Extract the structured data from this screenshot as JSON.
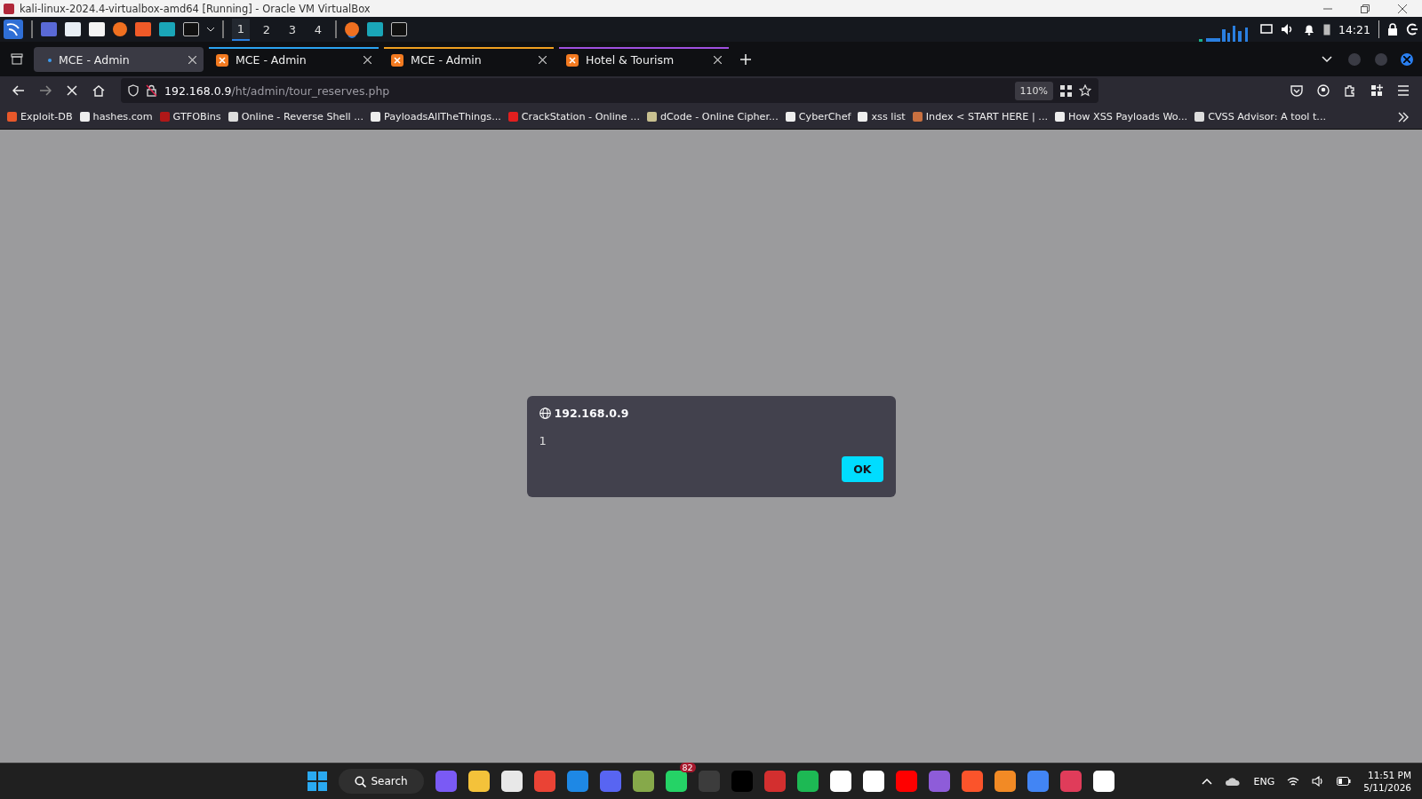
{
  "vm_window": {
    "title": "kali-linux-2024.4-virtualbox-amd64 [Running] - Oracle VM VirtualBox"
  },
  "kali_panel": {
    "workspaces": [
      {
        "label": "1",
        "selected": true
      },
      {
        "label": "2",
        "selected": false
      },
      {
        "label": "3",
        "selected": false
      },
      {
        "label": "4",
        "selected": false
      }
    ],
    "clock": "14:21"
  },
  "tabs": [
    {
      "label": "MCE - Admin",
      "selected": true,
      "color": "#3a3a44"
    },
    {
      "label": "MCE - Admin",
      "selected": false,
      "color": "#2ba3f0"
    },
    {
      "label": "MCE - Admin",
      "selected": false,
      "color": "#f0a020"
    },
    {
      "label": "Hotel & Tourism",
      "selected": false,
      "color": "#a050e0"
    }
  ],
  "address_bar": {
    "host": "192.168.0.9",
    "path": "/ht/admin/tour_reserves.php",
    "zoom": "110%"
  },
  "bookmarks": [
    "Exploit-DB",
    "hashes.com",
    "GTFOBins",
    "Online - Reverse Shell ...",
    "PayloadsAllTheThings...",
    "CrackStation - Online ...",
    "dCode - Online Cipher...",
    "CyberChef",
    "xss list",
    "Index < START HERE | ...",
    "How XSS Payloads Wo...",
    "CVSS Advisor: A tool t..."
  ],
  "alert_dialog": {
    "origin": "192.168.0.9",
    "message": "1",
    "button": "OK"
  },
  "taskbar": {
    "search": "Search",
    "badge": "82",
    "language": "ENG",
    "time": "11:51 PM",
    "date": "5/11/2026"
  }
}
